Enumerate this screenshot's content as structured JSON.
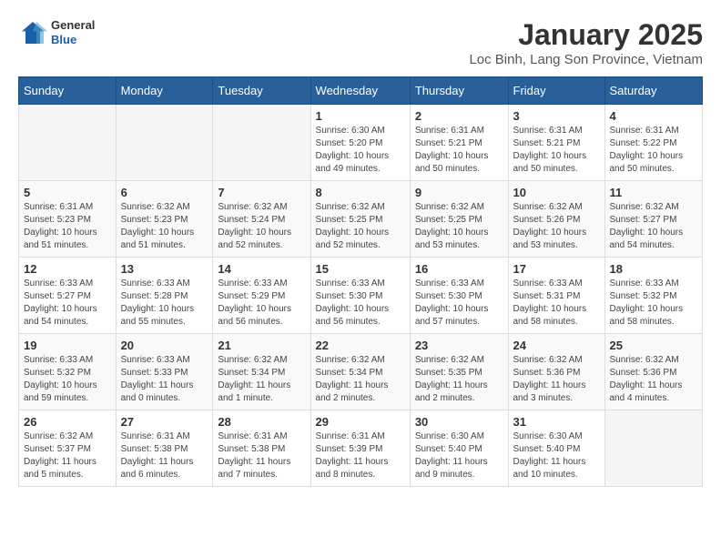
{
  "header": {
    "logo": {
      "general": "General",
      "blue": "Blue"
    },
    "title": "January 2025",
    "subtitle": "Loc Binh, Lang Son Province, Vietnam"
  },
  "weekdays": [
    "Sunday",
    "Monday",
    "Tuesday",
    "Wednesday",
    "Thursday",
    "Friday",
    "Saturday"
  ],
  "weeks": [
    [
      {
        "day": "",
        "info": ""
      },
      {
        "day": "",
        "info": ""
      },
      {
        "day": "",
        "info": ""
      },
      {
        "day": "1",
        "info": "Sunrise: 6:30 AM\nSunset: 5:20 PM\nDaylight: 10 hours\nand 49 minutes."
      },
      {
        "day": "2",
        "info": "Sunrise: 6:31 AM\nSunset: 5:21 PM\nDaylight: 10 hours\nand 50 minutes."
      },
      {
        "day": "3",
        "info": "Sunrise: 6:31 AM\nSunset: 5:21 PM\nDaylight: 10 hours\nand 50 minutes."
      },
      {
        "day": "4",
        "info": "Sunrise: 6:31 AM\nSunset: 5:22 PM\nDaylight: 10 hours\nand 50 minutes."
      }
    ],
    [
      {
        "day": "5",
        "info": "Sunrise: 6:31 AM\nSunset: 5:23 PM\nDaylight: 10 hours\nand 51 minutes."
      },
      {
        "day": "6",
        "info": "Sunrise: 6:32 AM\nSunset: 5:23 PM\nDaylight: 10 hours\nand 51 minutes."
      },
      {
        "day": "7",
        "info": "Sunrise: 6:32 AM\nSunset: 5:24 PM\nDaylight: 10 hours\nand 52 minutes."
      },
      {
        "day": "8",
        "info": "Sunrise: 6:32 AM\nSunset: 5:25 PM\nDaylight: 10 hours\nand 52 minutes."
      },
      {
        "day": "9",
        "info": "Sunrise: 6:32 AM\nSunset: 5:25 PM\nDaylight: 10 hours\nand 53 minutes."
      },
      {
        "day": "10",
        "info": "Sunrise: 6:32 AM\nSunset: 5:26 PM\nDaylight: 10 hours\nand 53 minutes."
      },
      {
        "day": "11",
        "info": "Sunrise: 6:32 AM\nSunset: 5:27 PM\nDaylight: 10 hours\nand 54 minutes."
      }
    ],
    [
      {
        "day": "12",
        "info": "Sunrise: 6:33 AM\nSunset: 5:27 PM\nDaylight: 10 hours\nand 54 minutes."
      },
      {
        "day": "13",
        "info": "Sunrise: 6:33 AM\nSunset: 5:28 PM\nDaylight: 10 hours\nand 55 minutes."
      },
      {
        "day": "14",
        "info": "Sunrise: 6:33 AM\nSunset: 5:29 PM\nDaylight: 10 hours\nand 56 minutes."
      },
      {
        "day": "15",
        "info": "Sunrise: 6:33 AM\nSunset: 5:30 PM\nDaylight: 10 hours\nand 56 minutes."
      },
      {
        "day": "16",
        "info": "Sunrise: 6:33 AM\nSunset: 5:30 PM\nDaylight: 10 hours\nand 57 minutes."
      },
      {
        "day": "17",
        "info": "Sunrise: 6:33 AM\nSunset: 5:31 PM\nDaylight: 10 hours\nand 58 minutes."
      },
      {
        "day": "18",
        "info": "Sunrise: 6:33 AM\nSunset: 5:32 PM\nDaylight: 10 hours\nand 58 minutes."
      }
    ],
    [
      {
        "day": "19",
        "info": "Sunrise: 6:33 AM\nSunset: 5:32 PM\nDaylight: 10 hours\nand 59 minutes."
      },
      {
        "day": "20",
        "info": "Sunrise: 6:33 AM\nSunset: 5:33 PM\nDaylight: 11 hours\nand 0 minutes."
      },
      {
        "day": "21",
        "info": "Sunrise: 6:32 AM\nSunset: 5:34 PM\nDaylight: 11 hours\nand 1 minute."
      },
      {
        "day": "22",
        "info": "Sunrise: 6:32 AM\nSunset: 5:34 PM\nDaylight: 11 hours\nand 2 minutes."
      },
      {
        "day": "23",
        "info": "Sunrise: 6:32 AM\nSunset: 5:35 PM\nDaylight: 11 hours\nand 2 minutes."
      },
      {
        "day": "24",
        "info": "Sunrise: 6:32 AM\nSunset: 5:36 PM\nDaylight: 11 hours\nand 3 minutes."
      },
      {
        "day": "25",
        "info": "Sunrise: 6:32 AM\nSunset: 5:36 PM\nDaylight: 11 hours\nand 4 minutes."
      }
    ],
    [
      {
        "day": "26",
        "info": "Sunrise: 6:32 AM\nSunset: 5:37 PM\nDaylight: 11 hours\nand 5 minutes."
      },
      {
        "day": "27",
        "info": "Sunrise: 6:31 AM\nSunset: 5:38 PM\nDaylight: 11 hours\nand 6 minutes."
      },
      {
        "day": "28",
        "info": "Sunrise: 6:31 AM\nSunset: 5:38 PM\nDaylight: 11 hours\nand 7 minutes."
      },
      {
        "day": "29",
        "info": "Sunrise: 6:31 AM\nSunset: 5:39 PM\nDaylight: 11 hours\nand 8 minutes."
      },
      {
        "day": "30",
        "info": "Sunrise: 6:30 AM\nSunset: 5:40 PM\nDaylight: 11 hours\nand 9 minutes."
      },
      {
        "day": "31",
        "info": "Sunrise: 6:30 AM\nSunset: 5:40 PM\nDaylight: 11 hours\nand 10 minutes."
      },
      {
        "day": "",
        "info": ""
      }
    ]
  ]
}
